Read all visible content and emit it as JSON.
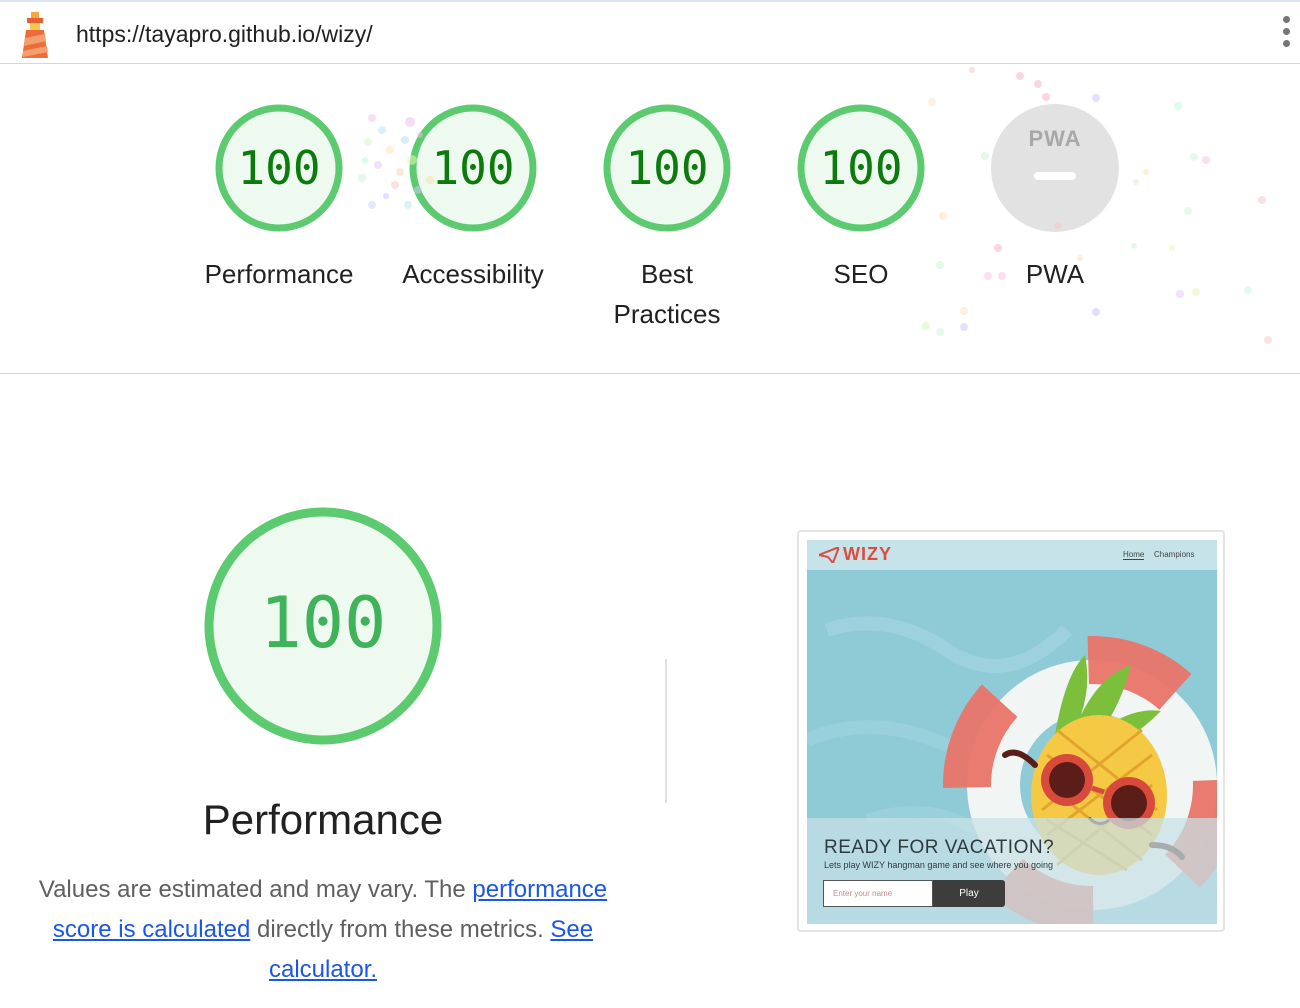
{
  "header": {
    "url": "https://tayapro.github.io/wizy/",
    "logo_icon": "lighthouse-icon",
    "menu_icon": "kebab-menu-icon"
  },
  "gauges": [
    {
      "score": "100",
      "label": "Performance"
    },
    {
      "score": "100",
      "label": "Accessibility"
    },
    {
      "score": "100",
      "label": "Best Practices"
    },
    {
      "score": "100",
      "label": "SEO"
    },
    {
      "score": "",
      "badge": "PWA",
      "label": "PWA"
    }
  ],
  "main": {
    "score": "100",
    "title": "Performance",
    "desc_prefix": "Values are estimated and may vary. The ",
    "desc_link1": "performance score is calculated",
    "desc_middle": " directly from these metrics. ",
    "desc_link2": "See calculator."
  },
  "screenshot": {
    "brand": "WIZY",
    "nav_home": "Home",
    "nav_champions": "Champions",
    "headline": "READY FOR VACATION?",
    "subline": "Lets play WIZY hangman game and see where you going",
    "input_placeholder": "Enter your name",
    "button": "Play"
  },
  "colors": {
    "pass_ring": "#5ccb6f",
    "pass_fill": "#eef9f0",
    "pass_text": "#0c7a0c",
    "pwa_grey": "#e2e2e2",
    "link": "#1a56e8"
  }
}
